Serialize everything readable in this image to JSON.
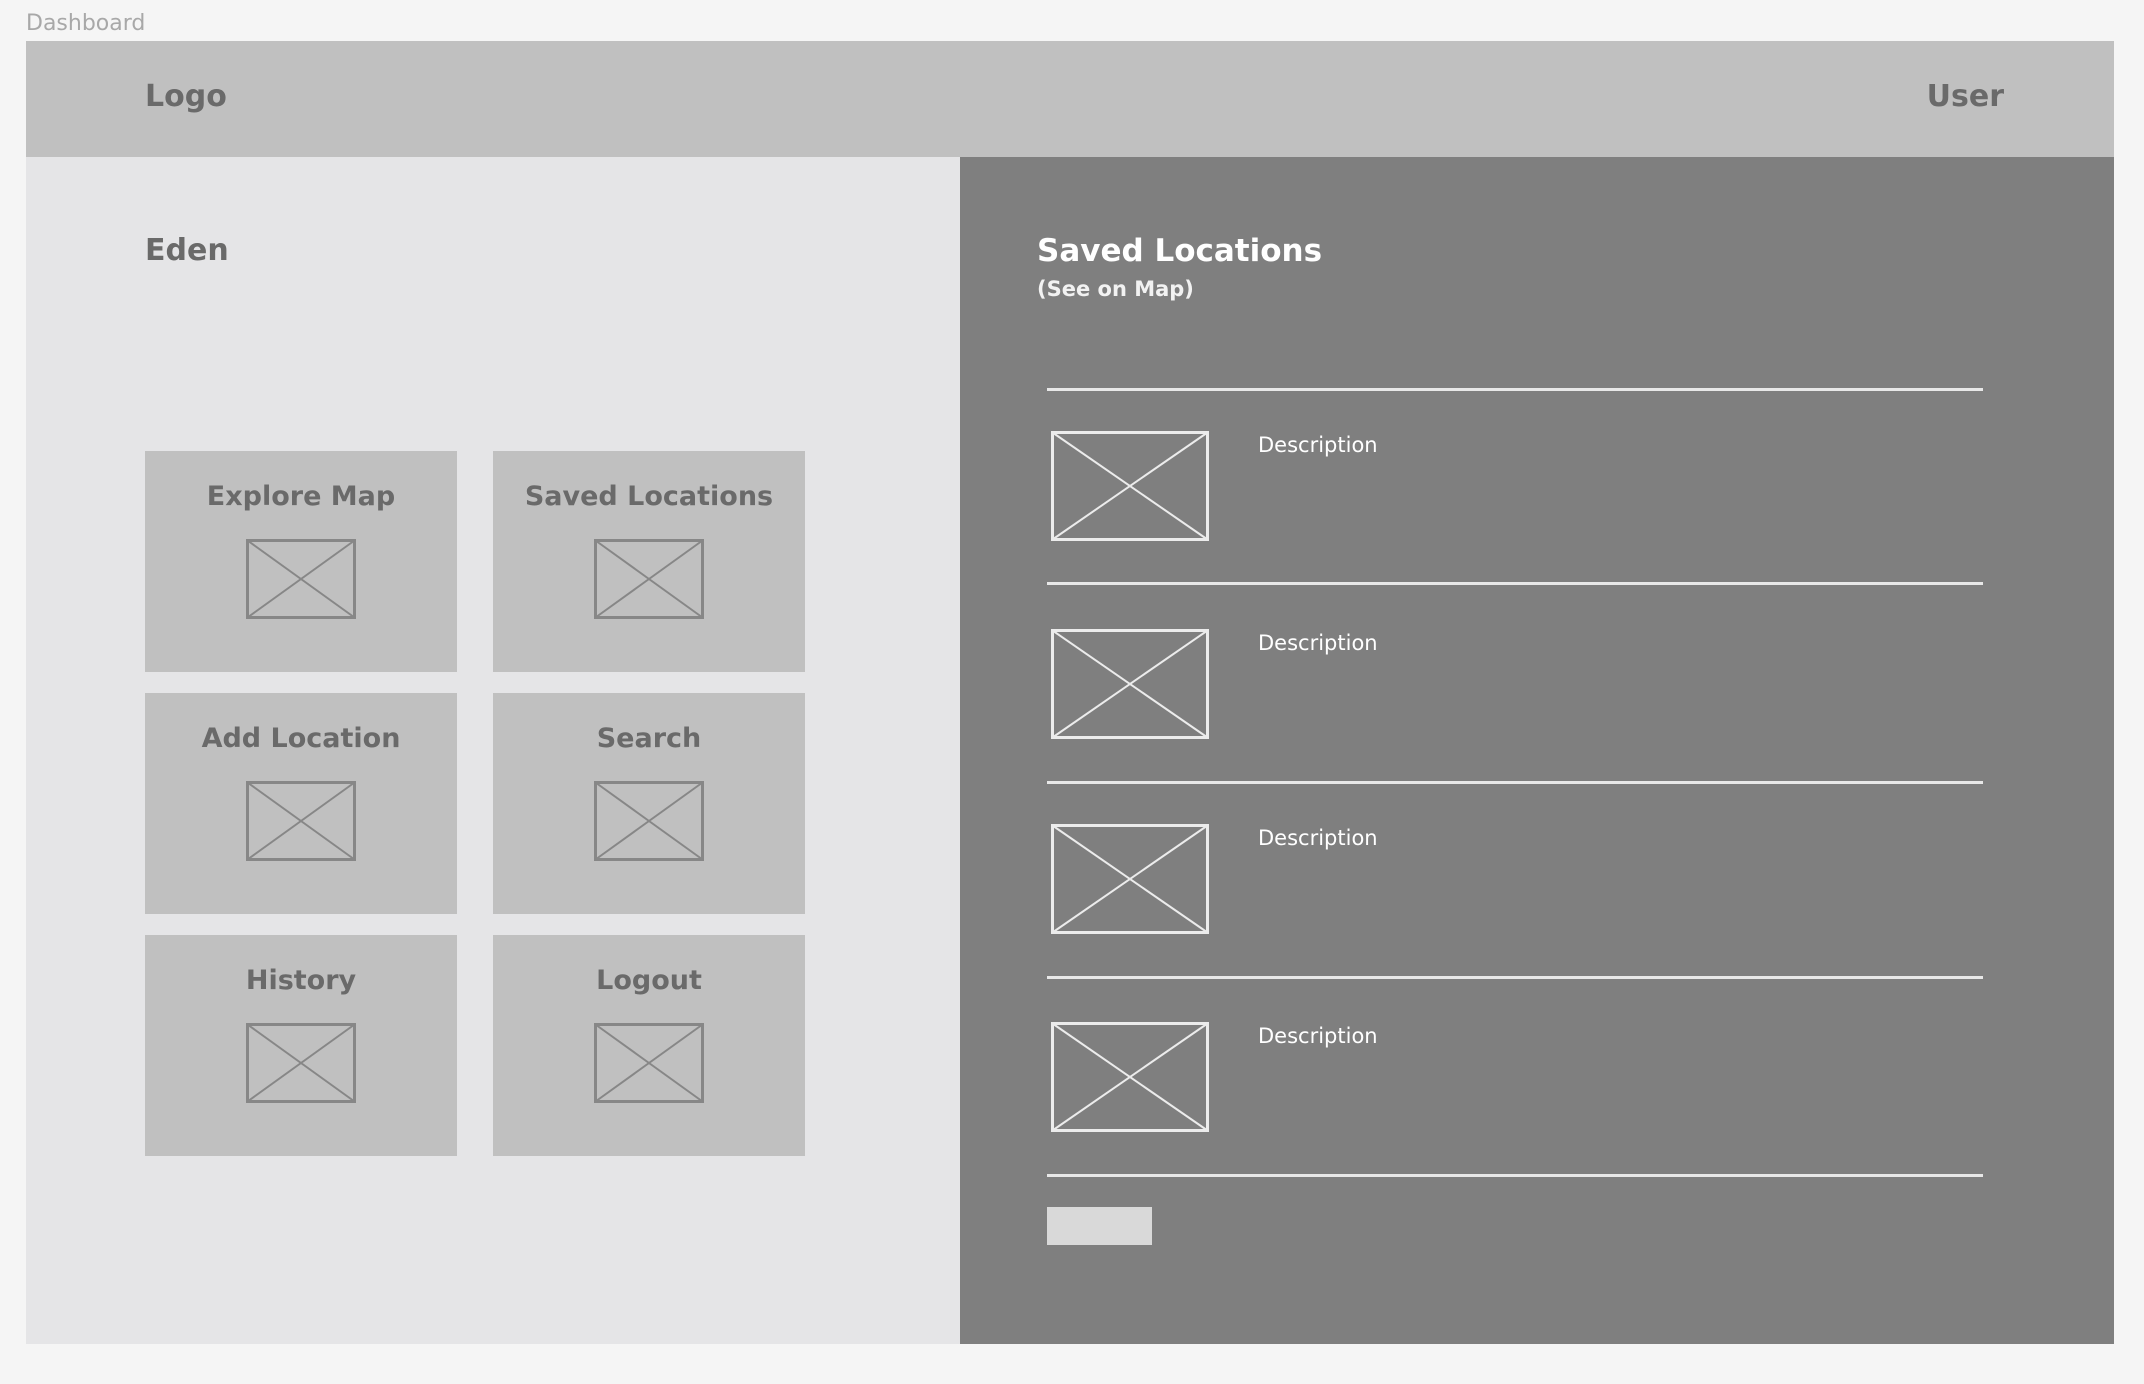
{
  "frame": {
    "label": "Dashboard"
  },
  "header": {
    "logo": "Logo",
    "user": "User"
  },
  "sidebar": {
    "app_name": "Eden",
    "tiles": [
      {
        "label": "Explore Map",
        "icon": "image-placeholder-icon"
      },
      {
        "label": "Saved Locations",
        "icon": "image-placeholder-icon"
      },
      {
        "label": "Add Location",
        "icon": "image-placeholder-icon"
      },
      {
        "label": "Search",
        "icon": "image-placeholder-icon"
      },
      {
        "label": "History",
        "icon": "image-placeholder-icon"
      },
      {
        "label": "Logout",
        "icon": "image-placeholder-icon"
      }
    ]
  },
  "saved": {
    "title": "Saved Locations",
    "subtitle": "(See on Map)",
    "items": [
      {
        "description": "Description"
      },
      {
        "description": "Description"
      },
      {
        "description": "Description"
      },
      {
        "description": "Description"
      }
    ]
  },
  "colors": {
    "background": "#f5f5f5",
    "header": "#c0c0c0",
    "left_panel": "#e5e5e7",
    "tile": "#c0c0c0",
    "right_panel": "#7f7f7f",
    "muted_text": "#6a6a6a",
    "light_text": "#ffffff"
  }
}
